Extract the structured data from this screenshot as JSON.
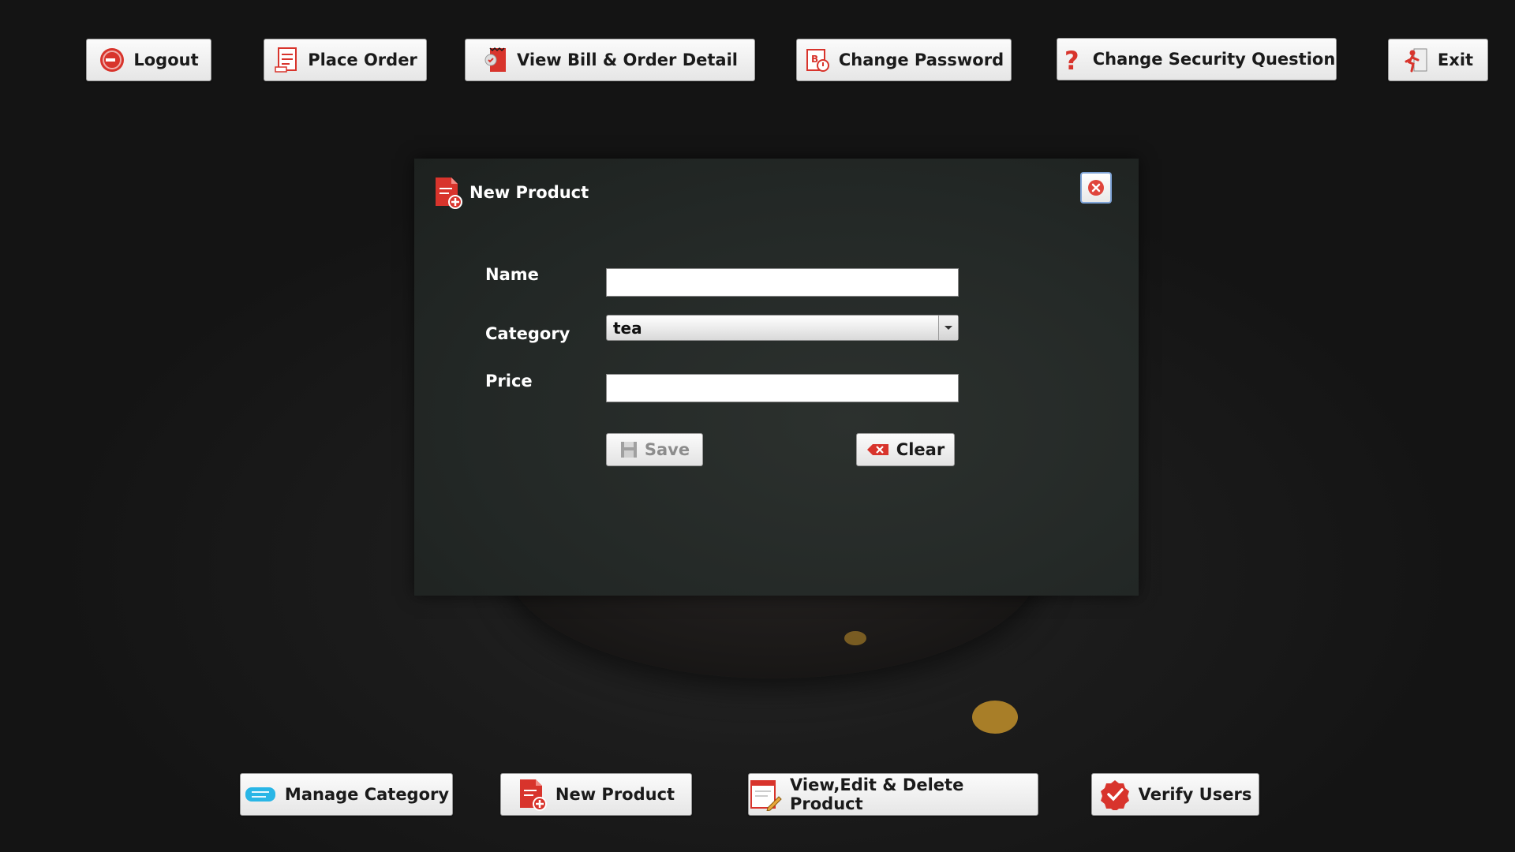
{
  "top_bar": {
    "logout": "Logout",
    "place_order": "Place Order",
    "view_bill": "View Bill & Order Detail",
    "change_password": "Change Password",
    "change_security": "Change Security Question",
    "exit": "Exit"
  },
  "dialog": {
    "title": "New Product",
    "name_label": "Name",
    "name_value": "",
    "category_label": "Category",
    "category_value": "tea",
    "price_label": "Price",
    "price_value": "",
    "save_label": "Save",
    "clear_label": "Clear"
  },
  "bottom_bar": {
    "manage_category": "Manage Category",
    "new_product": "New Product",
    "view_edit_delete": "View,Edit & Delete Product",
    "verify_users": "Verify Users"
  },
  "colors": {
    "accent_red": "#d8342c",
    "text_dark": "#1a1a1a",
    "disabled_text": "#8c8c8c"
  },
  "icons": {
    "logout": "power-icon",
    "place_order": "receipt-icon",
    "view_bill": "bill-check-icon",
    "change_password": "password-icon",
    "change_security": "question-icon",
    "exit": "exit-icon",
    "manage_category": "category-icon",
    "new_product": "add-document-icon",
    "view_edit_delete": "edit-document-icon",
    "verify_users": "verify-check-icon",
    "save": "floppy-icon",
    "clear": "eraser-icon",
    "close": "close-icon"
  }
}
